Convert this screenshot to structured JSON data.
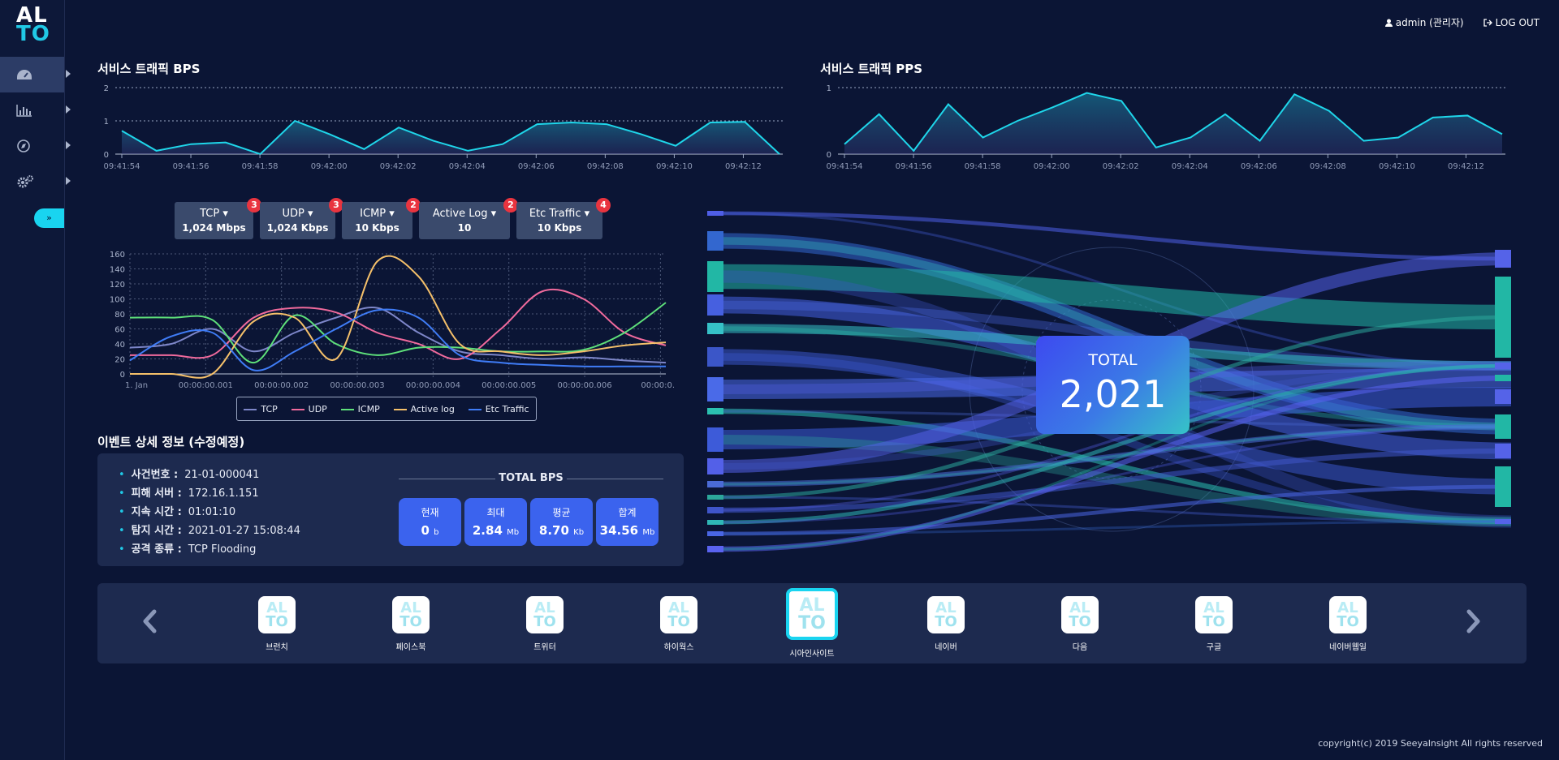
{
  "app": {
    "logo_top": "AL",
    "logo_bottom": "TO"
  },
  "topbar": {
    "user": "admin (관리자)",
    "logout": "LOG OUT"
  },
  "sidebar": {
    "items": [
      {
        "icon": "dashboard-icon",
        "active": true
      },
      {
        "icon": "bar-chart-icon",
        "active": false
      },
      {
        "icon": "compass-icon",
        "active": false
      },
      {
        "icon": "gears-icon",
        "active": false
      }
    ],
    "expand_label": "»"
  },
  "bps_chart": {
    "title": "서비스 트래픽 BPS",
    "chart_data": {
      "type": "area",
      "x": [
        "09:41:54",
        "",
        "09:41:56",
        "",
        "09:41:58",
        "",
        "09:42:00",
        "",
        "09:42:02",
        "",
        "09:42:04",
        "",
        "09:42:06",
        "",
        "09:42:08",
        "",
        "09:42:10",
        "",
        "09:42:12",
        ""
      ],
      "x_ticks": [
        "09:41:54",
        "09:41:56",
        "09:41:58",
        "09:42:00",
        "09:42:02",
        "09:42:04",
        "09:42:06",
        "09:42:08",
        "09:42:10",
        "09:42:12"
      ],
      "values": [
        0.7,
        0.1,
        0.3,
        0.35,
        0.0,
        1.0,
        0.6,
        0.15,
        0.8,
        0.4,
        0.1,
        0.3,
        0.9,
        0.95,
        0.9,
        0.6,
        0.25,
        0.95,
        0.97,
        0.0
      ],
      "ylim": [
        0,
        2
      ],
      "y_ticks": [
        0,
        1,
        2
      ],
      "color": "#1fd6ea"
    }
  },
  "pps_chart": {
    "title": "서비스 트래픽 PPS",
    "chart_data": {
      "type": "area",
      "x_ticks": [
        "09:41:54",
        "09:41:56",
        "09:41:58",
        "09:42:00",
        "09:42:02",
        "09:42:04",
        "09:42:06",
        "09:42:08",
        "09:42:10",
        "09:42:12"
      ],
      "values": [
        0.15,
        0.6,
        0.05,
        0.75,
        0.25,
        0.5,
        0.7,
        0.92,
        0.8,
        0.1,
        0.25,
        0.6,
        0.2,
        0.9,
        0.65,
        0.2,
        0.25,
        0.55,
        0.58,
        0.3
      ],
      "ylim": [
        0,
        1
      ],
      "y_ticks": [
        0,
        1
      ],
      "color": "#1fd6ea"
    }
  },
  "proto_tabs": [
    {
      "name": "TCP",
      "value": "1,024 Mbps",
      "badge": "3"
    },
    {
      "name": "UDP",
      "value": "1,024 Kbps",
      "badge": "3"
    },
    {
      "name": "ICMP",
      "value": "10 Kbps",
      "badge": "2"
    },
    {
      "name": "Active Log",
      "value": "10",
      "badge": "2"
    },
    {
      "name": "Etc Traffic",
      "value": "10 Kbps",
      "badge": "4"
    }
  ],
  "line_chart": {
    "chart_data": {
      "type": "line",
      "x_ticks": [
        "1. Jan",
        "00:00:00.001",
        "00:00:00.002",
        "00:00:00.003",
        "00:00:00.004",
        "00:00:00.005",
        "00:00:00.006",
        "00:00:0..."
      ],
      "ylim": [
        0,
        160
      ],
      "y_ticks": [
        0,
        20,
        40,
        60,
        80,
        100,
        120,
        140,
        160
      ],
      "series": [
        {
          "name": "TCP",
          "color": "#7d86c9",
          "values": [
            35,
            40,
            60,
            30,
            55,
            75,
            88,
            55,
            30,
            25,
            20,
            22,
            18,
            15
          ]
        },
        {
          "name": "UDP",
          "color": "#f06a9c",
          "values": [
            25,
            25,
            25,
            75,
            88,
            82,
            55,
            40,
            20,
            60,
            110,
            100,
            55,
            38
          ]
        },
        {
          "name": "ICMP",
          "color": "#5ee07a",
          "values": [
            75,
            75,
            72,
            15,
            78,
            40,
            25,
            35,
            35,
            30,
            30,
            32,
            55,
            95
          ]
        },
        {
          "name": "Active log",
          "color": "#f5c06a",
          "values": [
            0,
            0,
            0,
            70,
            75,
            20,
            150,
            130,
            40,
            30,
            25,
            30,
            38,
            42
          ]
        },
        {
          "name": "Etc Traffic",
          "color": "#3f7cf6",
          "values": [
            18,
            50,
            55,
            5,
            30,
            60,
            85,
            75,
            25,
            15,
            12,
            10,
            10,
            10
          ]
        }
      ]
    }
  },
  "event": {
    "title": "이벤트 상세 정보 (수정예정)",
    "rows": [
      {
        "label": "사건번호 :",
        "value": "21-01-000041"
      },
      {
        "label": "피해 서버 :",
        "value": "172.16.1.151"
      },
      {
        "label": "지속 시간 :",
        "value": "01:01:10"
      },
      {
        "label": "탐지 시간 :",
        "value": "2021-01-27 15:08:44"
      },
      {
        "label": "공격 종류 :",
        "value": "TCP Flooding"
      }
    ],
    "total_bps_title": "TOTAL BPS",
    "cards": [
      {
        "label": "현재",
        "value": "0",
        "unit": "b"
      },
      {
        "label": "최대",
        "value": "2.84",
        "unit": "Mb"
      },
      {
        "label": "평균",
        "value": "8.70",
        "unit": "Kb"
      },
      {
        "label": "합계",
        "value": "34.56",
        "unit": "Mb"
      }
    ]
  },
  "sankey": {
    "total_label": "TOTAL",
    "total_value": "2,021"
  },
  "sites": [
    {
      "name": "브런치",
      "selected": false
    },
    {
      "name": "페이스북",
      "selected": false
    },
    {
      "name": "트위터",
      "selected": false
    },
    {
      "name": "하이웍스",
      "selected": false
    },
    {
      "name": "시아인사이트",
      "selected": true
    },
    {
      "name": "네이버",
      "selected": false
    },
    {
      "name": "다음",
      "selected": false
    },
    {
      "name": "구글",
      "selected": false
    },
    {
      "name": "네이버웹일",
      "selected": false
    }
  ],
  "footer": "copyright(c) 2019 SeeyaInsight All rights reserved"
}
